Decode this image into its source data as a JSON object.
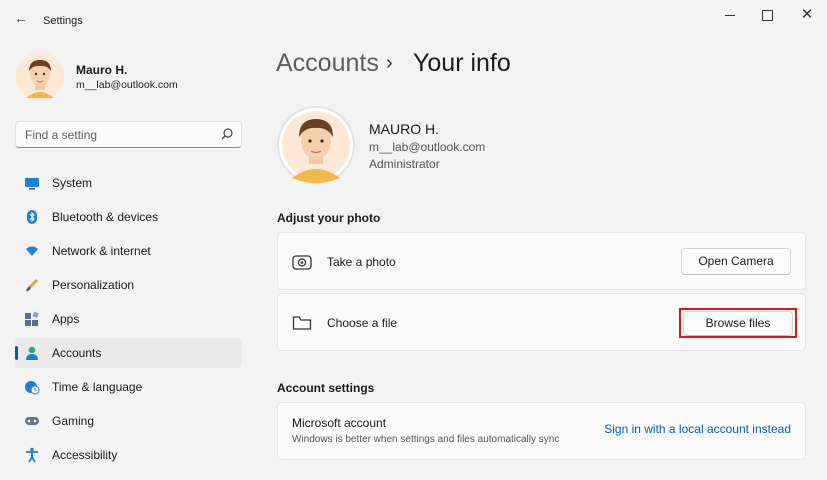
{
  "window": {
    "title": "Settings",
    "back_icon": "arrow-left-icon",
    "controls": [
      "minimize-icon",
      "maximize-icon",
      "close-icon"
    ]
  },
  "user": {
    "name": "Mauro H.",
    "email": "m__lab@outlook.com"
  },
  "search": {
    "placeholder": "Find a setting",
    "icon": "search-icon"
  },
  "sidebar": {
    "items": [
      {
        "label": "System",
        "icon": "system-monitor-icon",
        "active": false
      },
      {
        "label": "Bluetooth & devices",
        "icon": "bluetooth-icon",
        "active": false
      },
      {
        "label": "Network & internet",
        "icon": "wifi-icon",
        "active": false
      },
      {
        "label": "Personalization",
        "icon": "brush-icon",
        "active": false
      },
      {
        "label": "Apps",
        "icon": "apps-icon",
        "active": false
      },
      {
        "label": "Accounts",
        "icon": "person-icon",
        "active": true
      },
      {
        "label": "Time & language",
        "icon": "globe-clock-icon",
        "active": false
      },
      {
        "label": "Gaming",
        "icon": "gamepad-icon",
        "active": false
      },
      {
        "label": "Accessibility",
        "icon": "accessibility-icon",
        "active": false
      }
    ]
  },
  "breadcrumb": {
    "parent": "Accounts",
    "separator": "›",
    "current": "Your info"
  },
  "profile": {
    "name": "MAURO H.",
    "email": "m__lab@outlook.com",
    "role": "Administrator"
  },
  "adjust_photo": {
    "title": "Adjust your photo",
    "take_photo": {
      "label": "Take a photo",
      "icon": "camera-icon",
      "button": "Open Camera"
    },
    "choose_file": {
      "label": "Choose a file",
      "icon": "folder-icon",
      "button": "Browse files"
    }
  },
  "account_settings": {
    "title": "Account settings",
    "microsoft_account": {
      "title": "Microsoft account",
      "subtitle": "Windows is better when settings and files automatically sync",
      "link": "Sign in with a local account instead"
    }
  },
  "colors": {
    "accent": "#005fb8",
    "highlight": "#d7191c",
    "background": "#f3f3f3"
  }
}
